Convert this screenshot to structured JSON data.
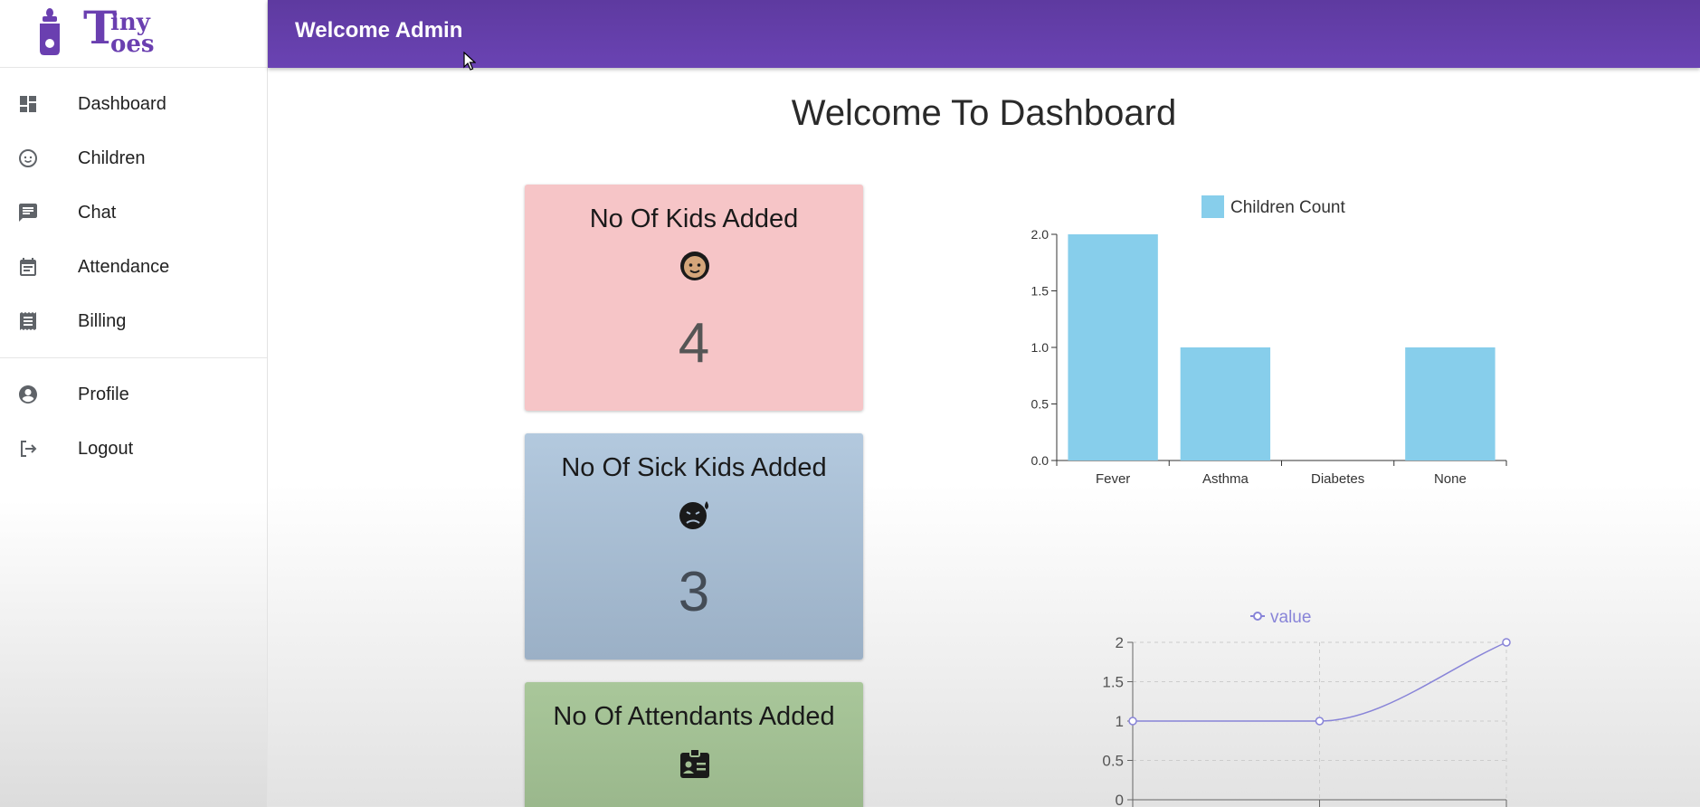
{
  "header": {
    "title": "Welcome Admin"
  },
  "page": {
    "title": "Welcome To Dashboard"
  },
  "logo": {
    "text_big": "T",
    "text_top": "iny",
    "text_bottom": "oes"
  },
  "sidebar": {
    "items": [
      {
        "label": "Dashboard",
        "icon": "dashboard-icon"
      },
      {
        "label": "Children",
        "icon": "child-face-icon"
      },
      {
        "label": "Chat",
        "icon": "chat-icon"
      },
      {
        "label": "Attendance",
        "icon": "calendar-icon"
      },
      {
        "label": "Billing",
        "icon": "receipt-icon"
      }
    ],
    "secondary": [
      {
        "label": "Profile",
        "icon": "account-circle-icon"
      },
      {
        "label": "Logout",
        "icon": "logout-icon"
      }
    ]
  },
  "cards": [
    {
      "title": "No Of Kids Added",
      "value": "4",
      "icon": "baby-face-icon",
      "color": "#f6c5c7"
    },
    {
      "title": "No Of Sick Kids Added",
      "value": "3",
      "icon": "sick-face-icon",
      "color": "#a9bdd3"
    },
    {
      "title": "No Of Attendants Added",
      "value": "",
      "icon": "badge-icon",
      "color": "#a2bf93"
    }
  ],
  "colors": {
    "accent": "#6a43b3",
    "bar": "#87ceeb",
    "line": "#8884d8"
  },
  "chart_data": [
    {
      "type": "bar",
      "categories": [
        "Fever",
        "Asthma",
        "Diabetes",
        "None"
      ],
      "series": [
        {
          "name": "Children Count",
          "values": [
            2,
            1,
            0,
            1
          ]
        }
      ],
      "ylim": [
        0,
        2
      ],
      "yticks": [
        "0.0",
        "0.5",
        "1.0",
        "1.5",
        "2.0"
      ],
      "legend": "top-center",
      "grid": false
    },
    {
      "type": "line",
      "series": [
        {
          "name": "value",
          "values": [
            1,
            1,
            2
          ]
        }
      ],
      "ylim": [
        0,
        2
      ],
      "yticks": [
        "0",
        "0.5",
        "1",
        "1.5",
        "2"
      ],
      "legend": "top-center",
      "grid": true
    }
  ]
}
